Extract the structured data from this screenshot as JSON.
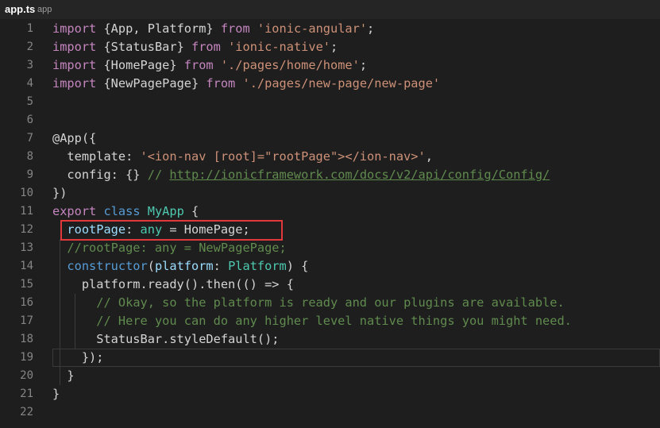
{
  "tab": {
    "filename": "app.ts",
    "folder": "app"
  },
  "colors": {
    "background": "#1e1e1e",
    "keyword": "#c586c0",
    "storage": "#569cd6",
    "string": "#ce9178",
    "comment": "#608b4e",
    "type": "#4ec9b0",
    "highlight_border": "#e2383c"
  },
  "lines": [
    {
      "n": "1",
      "tokens": [
        [
          "ks",
          "import"
        ],
        [
          "p",
          " {App, Platform} "
        ],
        [
          "ks",
          "from"
        ],
        [
          "p",
          " "
        ],
        [
          "s",
          "'ionic-angular'"
        ],
        [
          "p",
          ";"
        ]
      ]
    },
    {
      "n": "2",
      "tokens": [
        [
          "ks",
          "import"
        ],
        [
          "p",
          " {StatusBar} "
        ],
        [
          "ks",
          "from"
        ],
        [
          "p",
          " "
        ],
        [
          "s",
          "'ionic-native'"
        ],
        [
          "p",
          ";"
        ]
      ]
    },
    {
      "n": "3",
      "tokens": [
        [
          "ks",
          "import"
        ],
        [
          "p",
          " {HomePage} "
        ],
        [
          "ks",
          "from"
        ],
        [
          "p",
          " "
        ],
        [
          "s",
          "'./pages/home/home'"
        ],
        [
          "p",
          ";"
        ]
      ]
    },
    {
      "n": "4",
      "tokens": [
        [
          "ks",
          "import"
        ],
        [
          "p",
          " {NewPagePage} "
        ],
        [
          "ks",
          "from"
        ],
        [
          "p",
          " "
        ],
        [
          "s",
          "'./pages/new-page/new-page'"
        ]
      ]
    },
    {
      "n": "5",
      "tokens": []
    },
    {
      "n": "6",
      "tokens": []
    },
    {
      "n": "7",
      "tokens": [
        [
          "p",
          "@App({"
        ]
      ]
    },
    {
      "n": "8",
      "tokens": [
        [
          "p",
          "  template: "
        ],
        [
          "s",
          "'<ion-nav [root]=\"rootPage\"></ion-nav>'"
        ],
        [
          "p",
          ","
        ]
      ]
    },
    {
      "n": "9",
      "tokens": [
        [
          "p",
          "  config: {} "
        ],
        [
          "c",
          "// "
        ],
        [
          "cu",
          "http://ionicframework.com/docs/v2/api/config/Config/"
        ]
      ]
    },
    {
      "n": "10",
      "tokens": [
        [
          "p",
          "})"
        ]
      ]
    },
    {
      "n": "11",
      "tokens": [
        [
          "ks",
          "export"
        ],
        [
          "p",
          " "
        ],
        [
          "kw",
          "class"
        ],
        [
          "p",
          " "
        ],
        [
          "cls",
          "MyApp"
        ],
        [
          "p",
          " {"
        ]
      ]
    },
    {
      "n": "12",
      "tokens": [
        [
          "p",
          "  "
        ],
        [
          "v",
          "rootPage"
        ],
        [
          "p",
          ": "
        ],
        [
          "cls",
          "any"
        ],
        [
          "p",
          " = HomePage;"
        ]
      ]
    },
    {
      "n": "13",
      "tokens": [
        [
          "p",
          "  "
        ],
        [
          "c",
          "//rootPage: any = NewPagePage;"
        ]
      ]
    },
    {
      "n": "14",
      "tokens": [
        [
          "p",
          "  "
        ],
        [
          "kw",
          "constructor"
        ],
        [
          "p",
          "("
        ],
        [
          "v",
          "platform"
        ],
        [
          "p",
          ": "
        ],
        [
          "cls",
          "Platform"
        ],
        [
          "p",
          ") {"
        ]
      ]
    },
    {
      "n": "15",
      "tokens": [
        [
          "p",
          "    platform.ready().then(() => {"
        ]
      ]
    },
    {
      "n": "16",
      "tokens": [
        [
          "p",
          "      "
        ],
        [
          "c",
          "// Okay, so the platform is ready and our plugins are available."
        ]
      ]
    },
    {
      "n": "17",
      "tokens": [
        [
          "p",
          "      "
        ],
        [
          "c",
          "// Here you can do any higher level native things you might need."
        ]
      ]
    },
    {
      "n": "18",
      "tokens": [
        [
          "p",
          "      StatusBar.styleDefault();"
        ]
      ]
    },
    {
      "n": "19",
      "tokens": [
        [
          "p",
          "    });"
        ]
      ]
    },
    {
      "n": "20",
      "tokens": [
        [
          "p",
          "  }"
        ]
      ]
    },
    {
      "n": "21",
      "tokens": [
        [
          "p",
          "}"
        ]
      ]
    },
    {
      "n": "22",
      "tokens": []
    }
  ]
}
